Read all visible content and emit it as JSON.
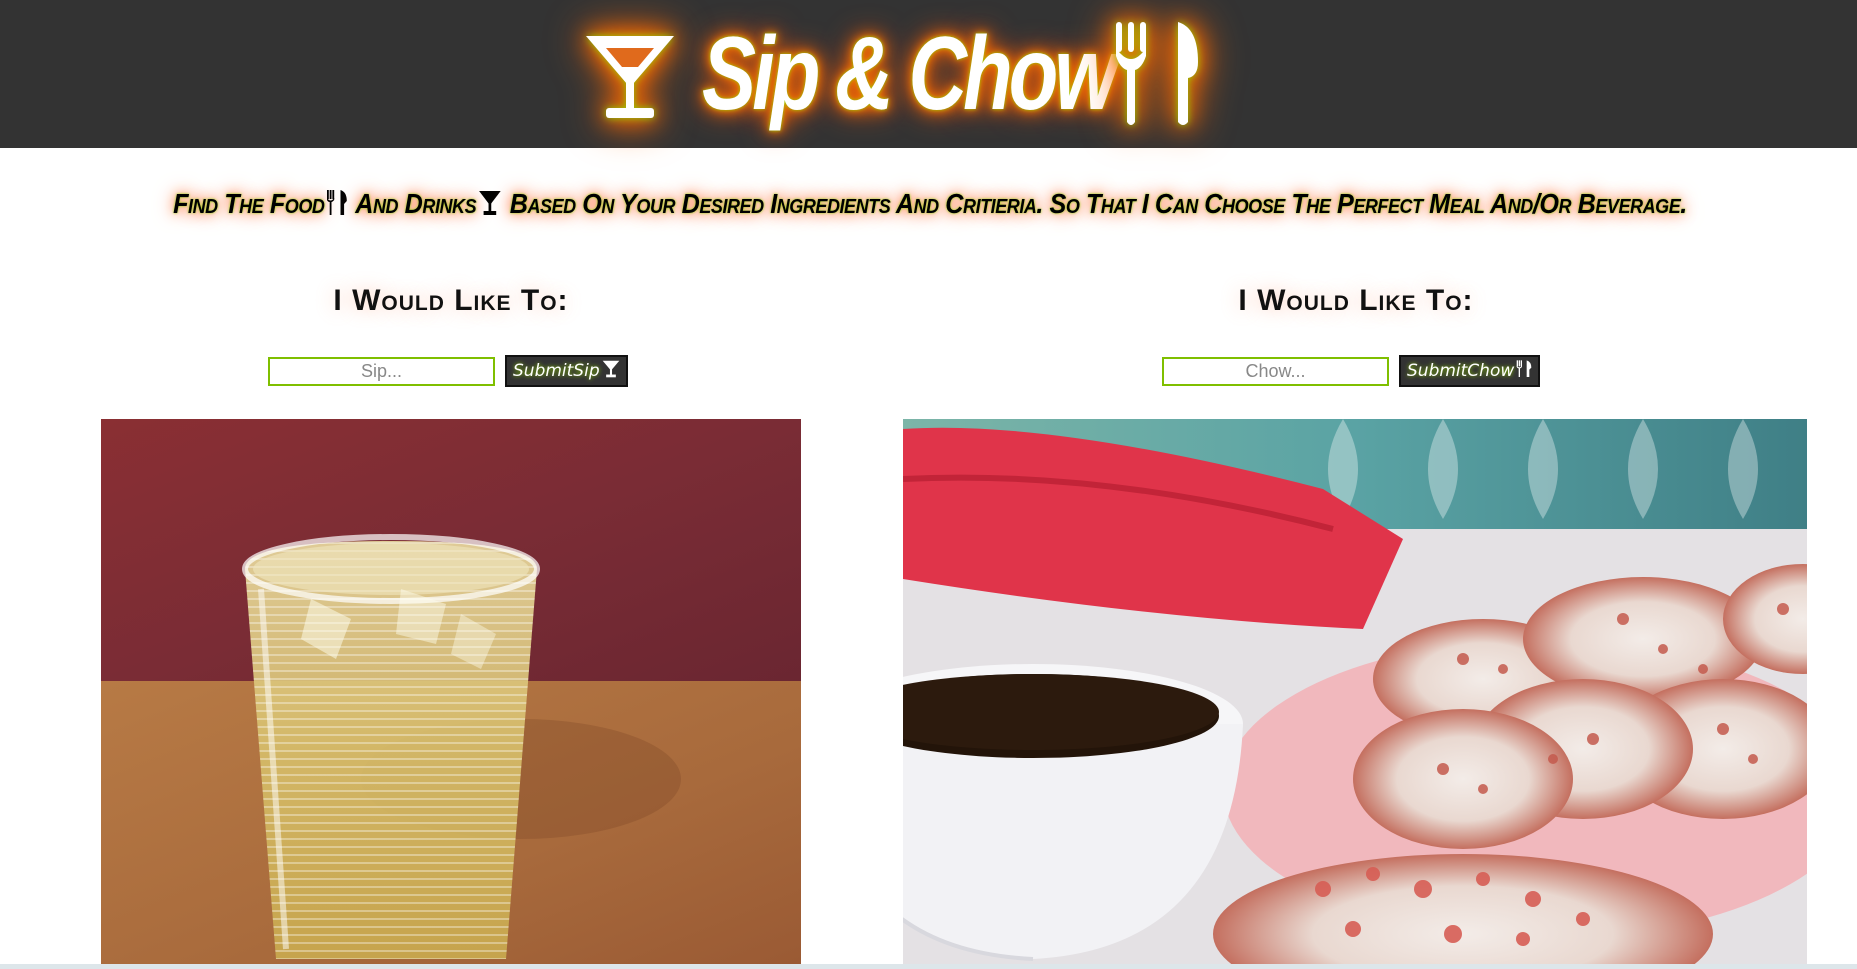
{
  "header": {
    "title": "Sip & Chow",
    "icons": [
      "cocktail-glass-icon",
      "fork-knife-icon"
    ]
  },
  "tagline": {
    "part1": "Find The Food",
    "part2": "And Drinks",
    "part3": "Based On Your Desired Ingredients And Critieria. So That I Can Choose The Perfect Meal And/Or Beverage."
  },
  "sip": {
    "heading": "I Would Like To:",
    "placeholder": "Sip...",
    "button_label": "SubmitSip",
    "image": "iced-drink-in-glass"
  },
  "chow": {
    "heading": "I Would Like To:",
    "placeholder": "Chow...",
    "button_label": "SubmitChow",
    "image": "red-velvet-donuts-with-coffee"
  },
  "colors": {
    "header_bg": "#333333",
    "accent_green": "#8fd400",
    "glow_orange": "#ff6a00"
  }
}
